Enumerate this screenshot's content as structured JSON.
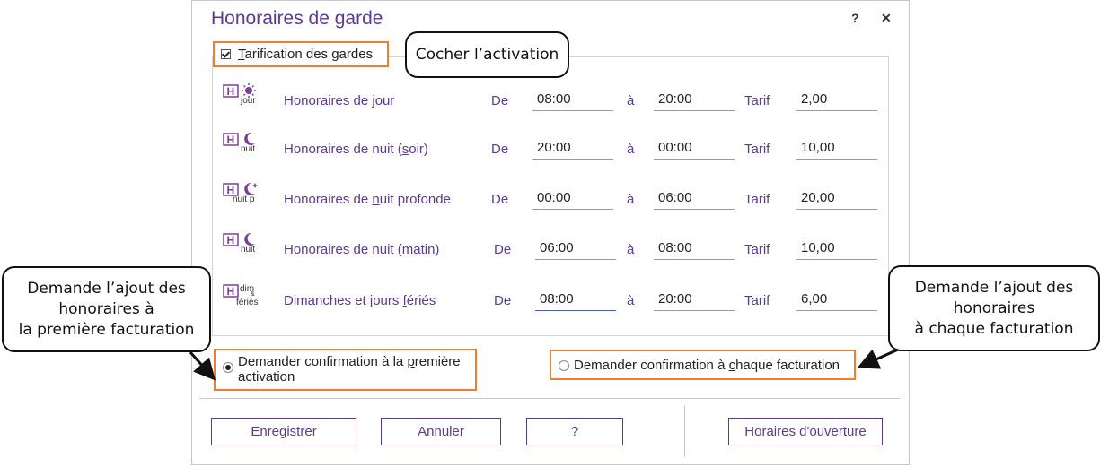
{
  "dialog": {
    "title": "Honoraires de garde",
    "help_glyph": "?",
    "close_glyph": "✕"
  },
  "activation": {
    "checked": true,
    "label_first": "T",
    "label_rest": "arification des gardes"
  },
  "rows": [
    {
      "icon": "day-fee-icon",
      "icon_caption": "jour",
      "label_pre": "Honoraires de jour",
      "label_u": "",
      "label_post": "",
      "de_label": "De",
      "from": "08:00",
      "a_label": "à",
      "to": "20:00",
      "tarif_label": "Tarif",
      "tarif": "2,00"
    },
    {
      "icon": "night-fee-icon",
      "icon_caption": "nuit",
      "label_pre": "Honoraires de nuit (",
      "label_u": "s",
      "label_post": "oir)",
      "de_label": "De",
      "from": "20:00",
      "a_label": "à",
      "to": "00:00",
      "tarif_label": "Tarif",
      "tarif": "10,00"
    },
    {
      "icon": "deep-night-fee-icon",
      "icon_caption": "nuit p",
      "label_pre": "Honoraires de ",
      "label_u": "n",
      "label_post": "uit profonde",
      "de_label": "De",
      "from": "00:00",
      "a_label": "à",
      "to": "06:00",
      "tarif_label": "Tarif",
      "tarif": "20,00"
    },
    {
      "icon": "night-morning-fee-icon",
      "icon_caption": "nuit",
      "label_pre": "Honoraires de nuit (",
      "label_u": "m",
      "label_post": "atin)",
      "de_label": "De",
      "from": "06:00",
      "a_label": "à",
      "to": "08:00",
      "tarif_label": "Tarif",
      "tarif": "10,00"
    },
    {
      "icon": "holiday-fee-icon",
      "icon_caption_top": "dim",
      "icon_caption_mid": "&",
      "icon_caption": "fériés",
      "label_pre": "Dimanches et jours ",
      "label_u": "f",
      "label_post": "ériés",
      "de_label": "De",
      "from": "08:00",
      "a_label": "à",
      "to": "20:00",
      "tarif_label": "Tarif",
      "tarif": "6,00"
    }
  ],
  "confirmation": {
    "first": {
      "selected": true,
      "pre": "Demander confirmation à la ",
      "u": "p",
      "post": "remière",
      "line2": "activation"
    },
    "each": {
      "selected": false,
      "pre": "Demander confirmation à ",
      "u": "c",
      "post": "haque facturation"
    }
  },
  "buttons": {
    "save_u": "E",
    "save_rest": "nregistrer",
    "cancel_u": "A",
    "cancel_rest": "nnuler",
    "help": "?",
    "hours_u": "H",
    "hours_rest": "oraires d'ouverture"
  },
  "callouts": {
    "activation": "Cocher l’activation",
    "left": [
      "Demande l’ajout des",
      "honoraires à",
      "la première facturation"
    ],
    "right": [
      "Demande l’ajout des",
      "honoraires",
      "à chaque facturation"
    ]
  },
  "colors": {
    "accent": "#5b3b8c",
    "highlight": "#ed7d31"
  }
}
